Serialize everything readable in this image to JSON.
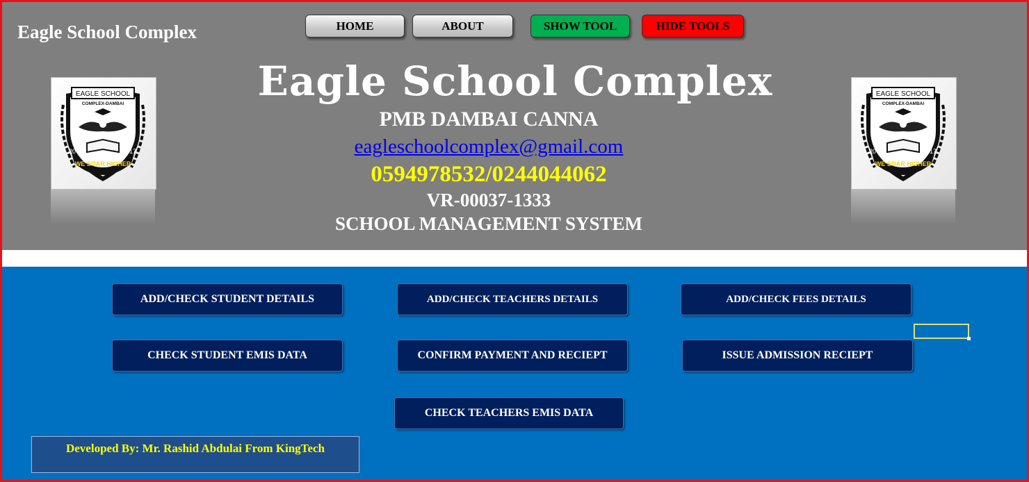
{
  "header": {
    "corner_title": "Eagle School Complex",
    "nav": {
      "home": "HOME",
      "about": "ABOUT",
      "show_tool": "SHOW TOOL",
      "hide_tools": "HIDE TOOLS"
    },
    "title": "Eagle School Complex",
    "address": "PMB DAMBAI CANNA",
    "email": "eagleschoolcomplex@gmail.com",
    "phones": "0594978532/0244044062",
    "reg_number": "VR-00037-1333",
    "subtitle": "SCHOOL MANAGEMENT SYSTEM"
  },
  "logo": {
    "top_text": "EAGLE SCHOOL",
    "sub_text": "COMPLEX-DAMBAI",
    "motto": "WE SOAR HIGHER",
    "year_left": "20",
    "year_right": "17"
  },
  "actions": {
    "add_student": "ADD/CHECK STUDENT DETAILS",
    "add_teachers": "ADD/CHECK TEACHERS DETAILS",
    "add_fees": "ADD/CHECK FEES DETAILS",
    "student_emis": "CHECK STUDENT EMIS DATA",
    "confirm_payment": "CONFIRM PAYMENT AND RECIEPT",
    "admission_receipt": "ISSUE ADMISSION RECIEPT",
    "teachers_emis": "CHECK TEACHERS EMIS DATA"
  },
  "footer": {
    "developer": "Developed By: Mr. Rashid Abdulai From KingTech"
  },
  "colors": {
    "header_bg": "#7f7f7f",
    "main_bg": "#0070c0",
    "frame_border": "#e8121b",
    "action_button_bg": "#001f5c",
    "accent_yellow": "#ffff00",
    "show_tool_green": "#00b050",
    "hide_tools_red": "#ff0000"
  }
}
